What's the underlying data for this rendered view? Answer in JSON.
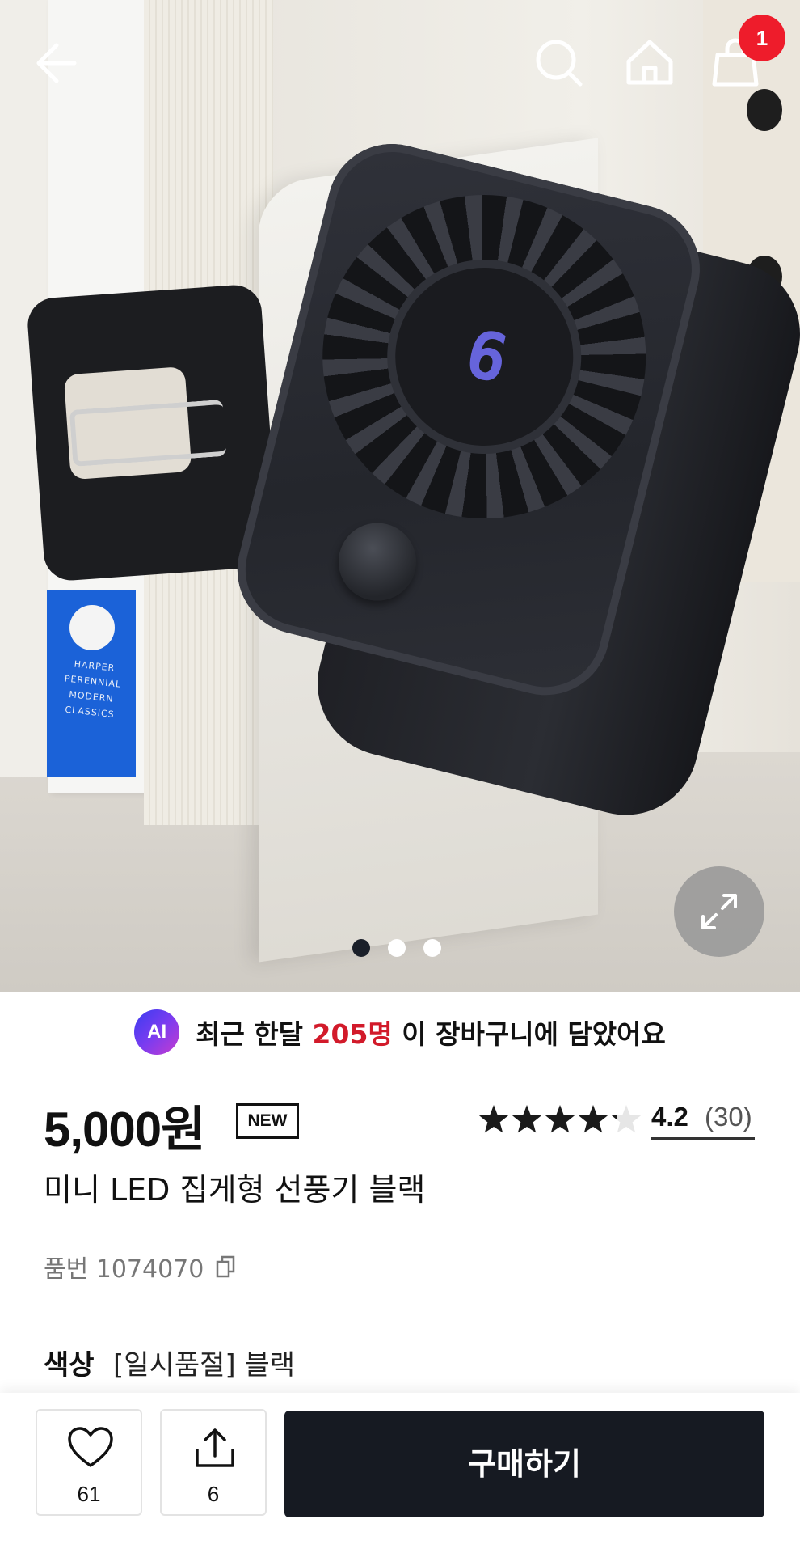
{
  "header": {
    "cart_badge": "1"
  },
  "gallery": {
    "book_spine_text": "HARPER PERENNIAL MODERN CLASSICS",
    "fan_display": "6",
    "pages": 3,
    "active_page": 1
  },
  "banner": {
    "ai_label": "AI",
    "prefix": "최근 한달",
    "count": "205명",
    "suffix": "이 장바구니에 담았어요"
  },
  "product": {
    "price": "5,000원",
    "badge": "NEW",
    "rating": "4.2",
    "rating_value": 4.2,
    "review_count": "(30)",
    "name": "미니 LED 집게형 선풍기 블랙",
    "item_number": "품번 1074070",
    "color_label": "색상",
    "color_value": "[일시품절] 블랙"
  },
  "bottom_bar": {
    "like_count": "61",
    "share_count": "6",
    "buy_label": "구매하기"
  },
  "colors": {
    "accent_red": "#d21a2a",
    "badge_red": "#ee1c2b",
    "buy_button": "#161a22",
    "star": "#1a1a1a"
  }
}
